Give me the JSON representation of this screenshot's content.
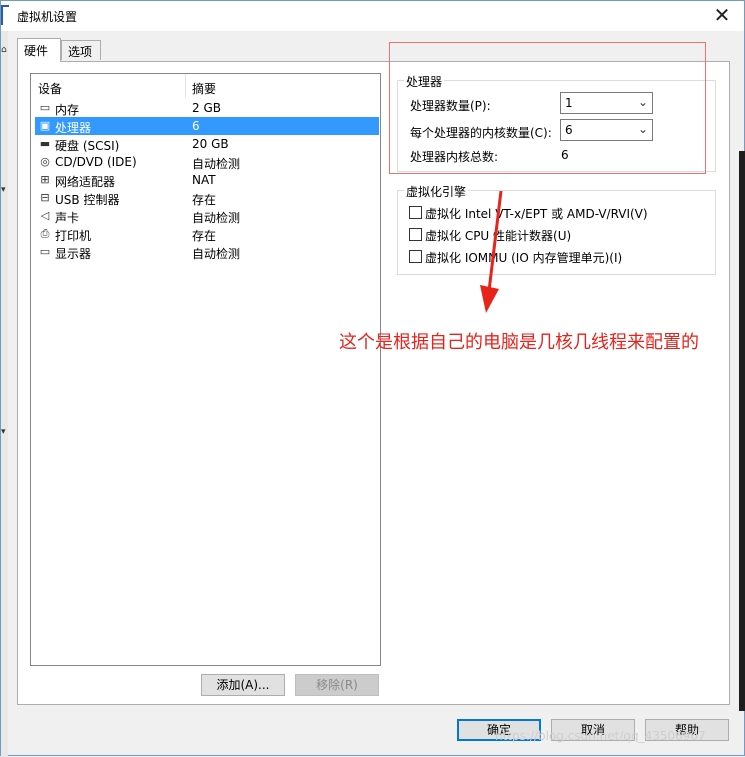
{
  "window": {
    "title": "虚拟机设置",
    "close_glyph": "✕"
  },
  "tabs": [
    {
      "label": "硬件",
      "active": true
    },
    {
      "label": "选项",
      "active": false
    }
  ],
  "device_table": {
    "columns": [
      "设备",
      "摘要"
    ],
    "rows": [
      {
        "icon": "memory-icon",
        "name": "内存",
        "summary": "2 GB",
        "selected": false
      },
      {
        "icon": "processor-icon",
        "name": "处理器",
        "summary": "6",
        "selected": true
      },
      {
        "icon": "hard-disk-icon",
        "name": "硬盘 (SCSI)",
        "summary": "20 GB",
        "selected": false
      },
      {
        "icon": "cd-dvd-icon",
        "name": "CD/DVD (IDE)",
        "summary": "自动检测",
        "selected": false
      },
      {
        "icon": "network-adapter-icon",
        "name": "网络适配器",
        "summary": "NAT",
        "selected": false
      },
      {
        "icon": "usb-icon",
        "name": "USB 控制器",
        "summary": "存在",
        "selected": false
      },
      {
        "icon": "sound-card-icon",
        "name": "声卡",
        "summary": "自动检测",
        "selected": false
      },
      {
        "icon": "printer-icon",
        "name": "打印机",
        "summary": "存在",
        "selected": false
      },
      {
        "icon": "display-icon",
        "name": "显示器",
        "summary": "自动检测",
        "selected": false
      }
    ]
  },
  "list_buttons": {
    "add": "添加(A)...",
    "remove": "移除(R)"
  },
  "processor_group": {
    "title": "处理器",
    "count_label": "处理器数量(P):",
    "count_value": "1",
    "cores_label": "每个处理器的内核数量(C):",
    "cores_value": "6",
    "total_label": "处理器内核总数:",
    "total_value": "6"
  },
  "virtualization_group": {
    "title": "虚拟化引擎",
    "options": [
      {
        "label": "虚拟化 Intel VT-x/EPT 或 AMD-V/RVI(V)",
        "checked": false
      },
      {
        "label": "虚拟化 CPU 性能计数器(U)",
        "checked": false
      },
      {
        "label": "虚拟化 IOMMU (IO 内存管理单元)(I)",
        "checked": false
      }
    ]
  },
  "annotation": {
    "text": "这个是根据自己的电脑是几核几线程来配置的",
    "color": "#e8231c"
  },
  "footer": {
    "ok": "确定",
    "cancel": "取消",
    "help": "帮助"
  },
  "watermark": "https://blog.csdn.net/qq_43506907",
  "colors": {
    "selection": "#3399ff",
    "accent": "#0078d7"
  }
}
